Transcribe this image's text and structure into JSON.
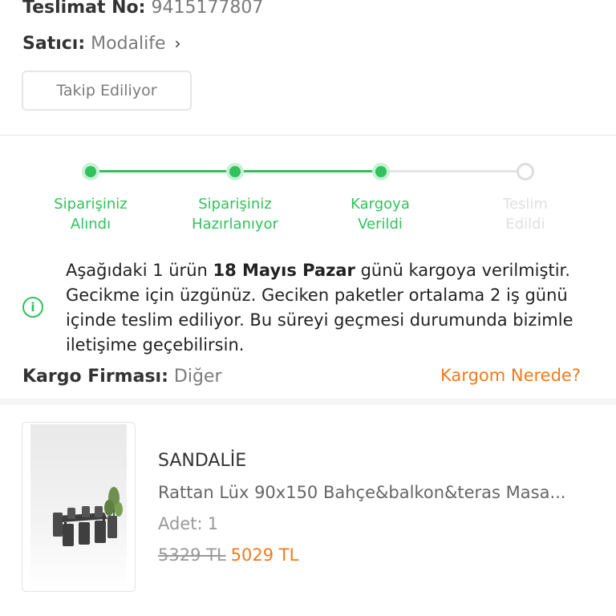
{
  "order": {
    "delivery_no_label": "Teslimat No:",
    "delivery_no_value": "9415177807",
    "seller_label": "Satıcı:",
    "seller_value": "Modalife",
    "follow_button_label": "Takip Ediliyor"
  },
  "tracker": {
    "steps": [
      {
        "line1": "Siparişiniz",
        "line2": "Alındı",
        "state": "done"
      },
      {
        "line1": "Siparişiniz",
        "line2": "Hazırlanıyor",
        "state": "done"
      },
      {
        "line1": "Kargoya",
        "line2": "Verildi",
        "state": "done"
      },
      {
        "line1": "Teslim",
        "line2": "Edildi",
        "state": "pending"
      }
    ],
    "colors": {
      "done": "#30c25b",
      "pending": "#dddddd"
    }
  },
  "info": {
    "icon": "info-icon",
    "icon_glyph": "i",
    "text_before": "Aşağıdaki 1 ürün ",
    "date": "18 Mayıs Pazar",
    "text_after": " günü kargoya verilmiştir. Gecikme için üzgünüz. Geciken paketler ortalama 2 iş günü içinde teslim ediliyor. Bu süreyi geçmesi durumunda bizimle iletişime geçebilirsin."
  },
  "cargo": {
    "firm_label": "Kargo Firması:",
    "firm_value": "Diğer",
    "where_link": "Kargom Nerede?"
  },
  "product": {
    "brand": "SANDALİE",
    "name": "Rattan Lüx 90x150 Bahçe&balkon&teras Masa...",
    "qty_label": "Adet:",
    "qty_value": "1",
    "old_price": "5329 TL",
    "new_price": "5029 TL"
  },
  "accent_color": "#f27a1a"
}
